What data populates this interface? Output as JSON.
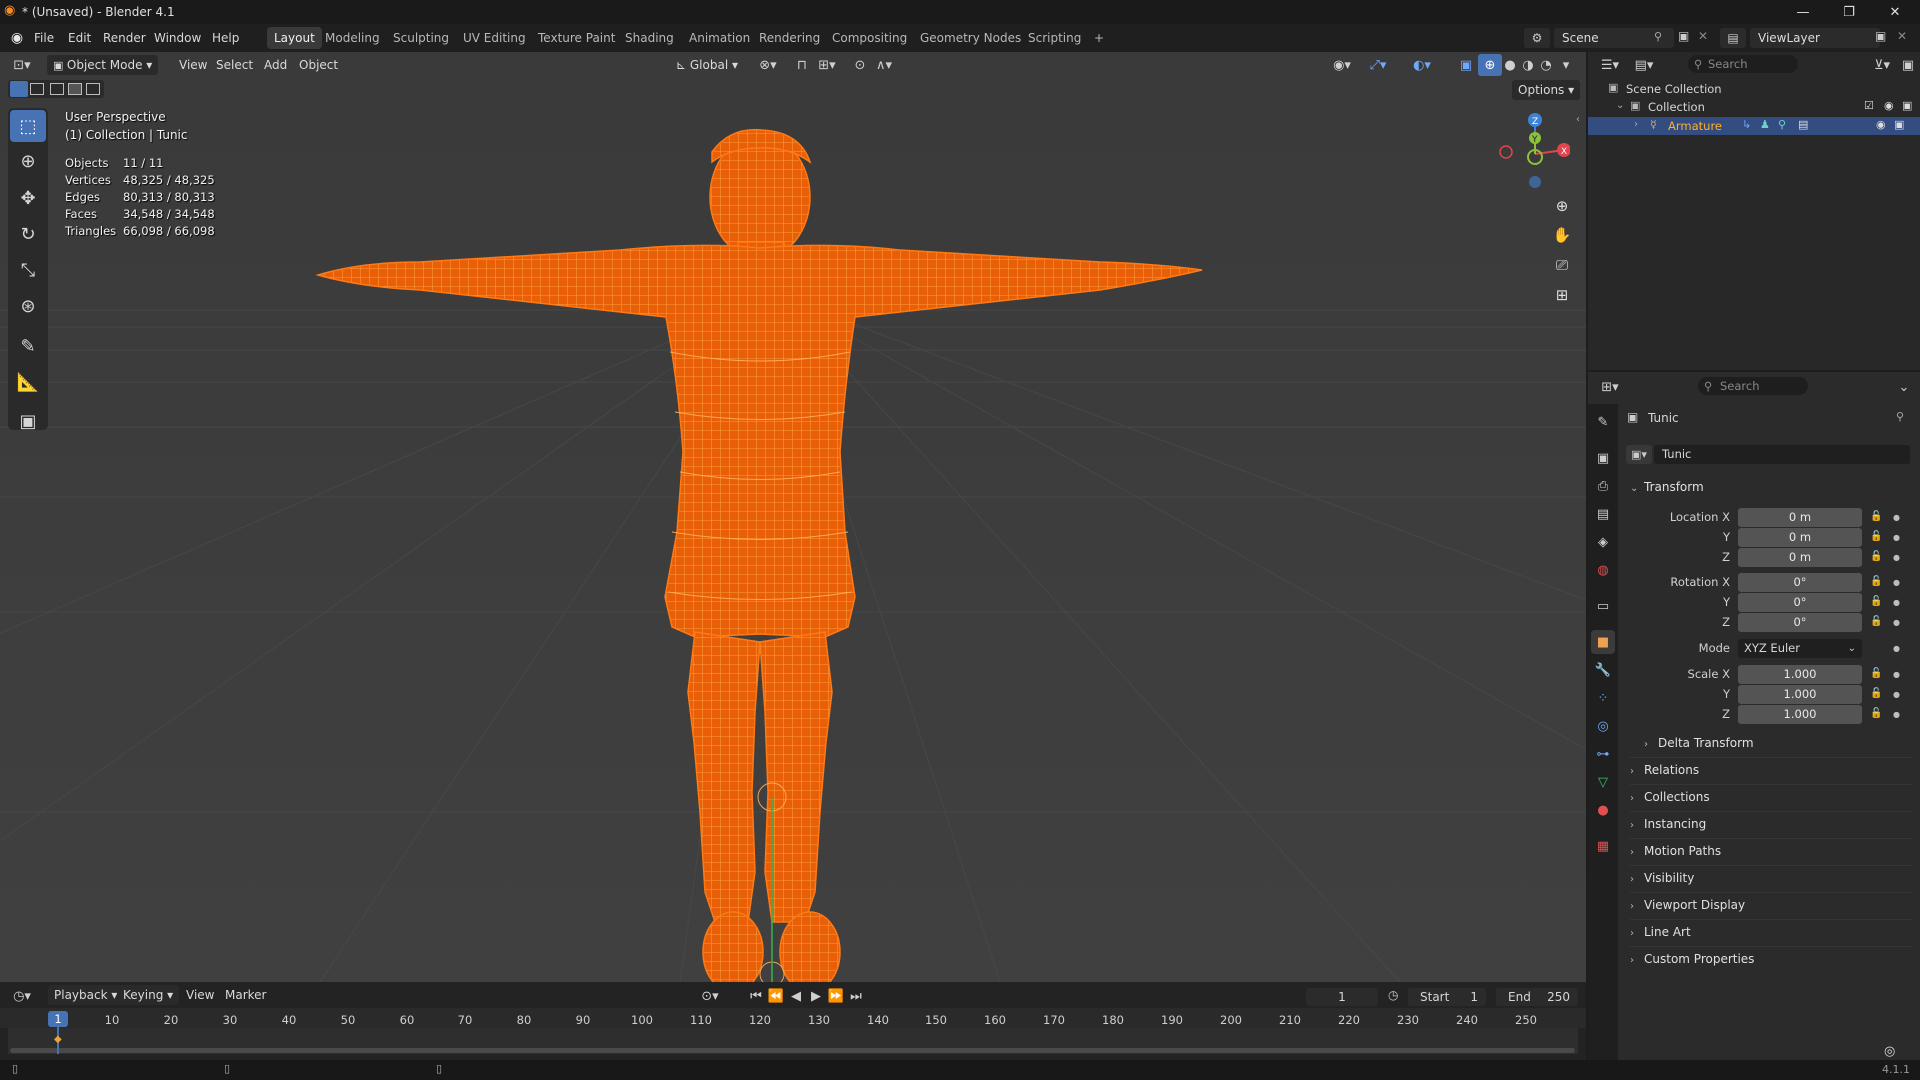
{
  "window": {
    "title": "* (Unsaved) - Blender 4.1",
    "controls": [
      "—",
      "❐",
      "✕"
    ]
  },
  "menus": [
    "File",
    "Edit",
    "Render",
    "Window",
    "Help"
  ],
  "workspaces": [
    "Layout",
    "Modeling",
    "Sculpting",
    "UV Editing",
    "Texture Paint",
    "Shading",
    "Animation",
    "Rendering",
    "Compositing",
    "Geometry Nodes",
    "Scripting"
  ],
  "active_workspace": "Layout",
  "add_workspace_icon": "+",
  "scene": {
    "name": "Scene",
    "view_layer": "ViewLayer"
  },
  "viewport_header": {
    "mode": "Object Mode",
    "menus": [
      "View",
      "Select",
      "Add",
      "Object"
    ],
    "transform_orientation": "Global",
    "options_label": "Options"
  },
  "viewport_overlay": {
    "view_name": "User Perspective",
    "collection_line": "(1) Collection | Tunic",
    "stats": [
      {
        "label": "Objects",
        "value": "11 / 11"
      },
      {
        "label": "Vertices",
        "value": "48,325 / 48,325"
      },
      {
        "label": "Edges",
        "value": "80,313 / 80,313"
      },
      {
        "label": "Faces",
        "value": "34,548 / 34,548"
      },
      {
        "label": "Triangles",
        "value": "66,098 / 66,098"
      }
    ]
  },
  "gizmo_axes": {
    "x": "X",
    "y": "Y",
    "z": "Z"
  },
  "colors": {
    "wire": "#ff6a00",
    "accent": "#4772b3",
    "axis_x": "#e0454e",
    "axis_y": "#8bc23a",
    "axis_z": "#3f83d6"
  },
  "outliner": {
    "search_placeholder": "Search",
    "root": "Scene Collection",
    "collection": "Collection",
    "object": "Armature"
  },
  "properties": {
    "search_placeholder": "Search",
    "object_name": "Tunic",
    "object_field": "Tunic",
    "transform_title": "Transform",
    "location": [
      {
        "label": "Location X",
        "value": "0 m"
      },
      {
        "label": "Y",
        "value": "0 m"
      },
      {
        "label": "Z",
        "value": "0 m"
      }
    ],
    "rotation": [
      {
        "label": "Rotation X",
        "value": "0°"
      },
      {
        "label": "Y",
        "value": "0°"
      },
      {
        "label": "Z",
        "value": "0°"
      }
    ],
    "mode_label": "Mode",
    "mode_value": "XYZ Euler",
    "scale": [
      {
        "label": "Scale X",
        "value": "1.000"
      },
      {
        "label": "Y",
        "value": "1.000"
      },
      {
        "label": "Z",
        "value": "1.000"
      }
    ],
    "subpanels": [
      "Delta Transform"
    ],
    "panels": [
      "Relations",
      "Collections",
      "Instancing",
      "Motion Paths",
      "Visibility",
      "Viewport Display",
      "Line Art",
      "Custom Properties"
    ]
  },
  "timeline": {
    "menus": [
      "Playback",
      "Keying",
      "View",
      "Marker"
    ],
    "current_frame": "1",
    "start_label": "Start",
    "start_value": "1",
    "end_label": "End",
    "end_value": "250",
    "ruler": [
      "1",
      "10",
      "20",
      "30",
      "40",
      "50",
      "60",
      "70",
      "80",
      "90",
      "100",
      "110",
      "120",
      "130",
      "140",
      "150",
      "160",
      "170",
      "180",
      "190",
      "200",
      "210",
      "220",
      "230",
      "240",
      "250"
    ]
  },
  "status": {
    "version": "4.1.1"
  }
}
